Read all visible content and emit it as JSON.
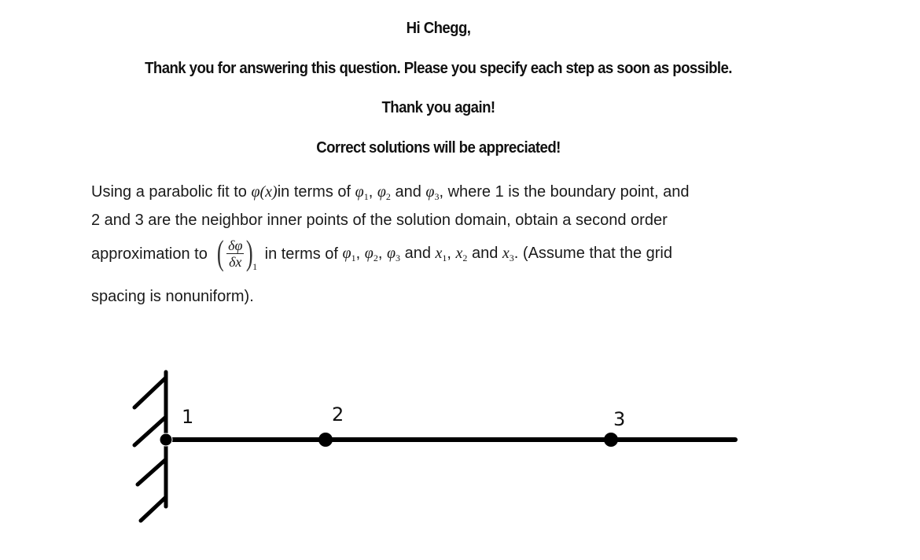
{
  "header": {
    "greeting": "Hi Chegg,",
    "line1": "Thank you for answering this question. Please you specify each step as soon as possible.",
    "line2": "Thank you again!",
    "line3": "Correct solutions will be appreciated!"
  },
  "question": {
    "p1_a": "Using a parabolic fit to ",
    "phi_x": "φ(x)",
    "p1_b": "in terms of ",
    "phi": "φ",
    "sub1": "1",
    "sub2": "2",
    "sub3": "3",
    "comma": ", ",
    "and": " and ",
    "p1_c": ", where 1 is the boundary point, and",
    "line2": "2 and 3 are the neighbor inner points of the solution domain, obtain a second order",
    "p3_a": "approximation to ",
    "frac_num": "δφ",
    "frac_den": "δx",
    "frac_sub": "1",
    "p3_b": " in terms of ",
    "x": "x",
    "p3_c": ". (Assume that the grid",
    "line4": "spacing is nonuniform)."
  },
  "diagram": {
    "nodes": [
      {
        "label": "1",
        "type": "boundary"
      },
      {
        "label": "2",
        "type": "inner"
      },
      {
        "label": "3",
        "type": "inner"
      }
    ]
  }
}
